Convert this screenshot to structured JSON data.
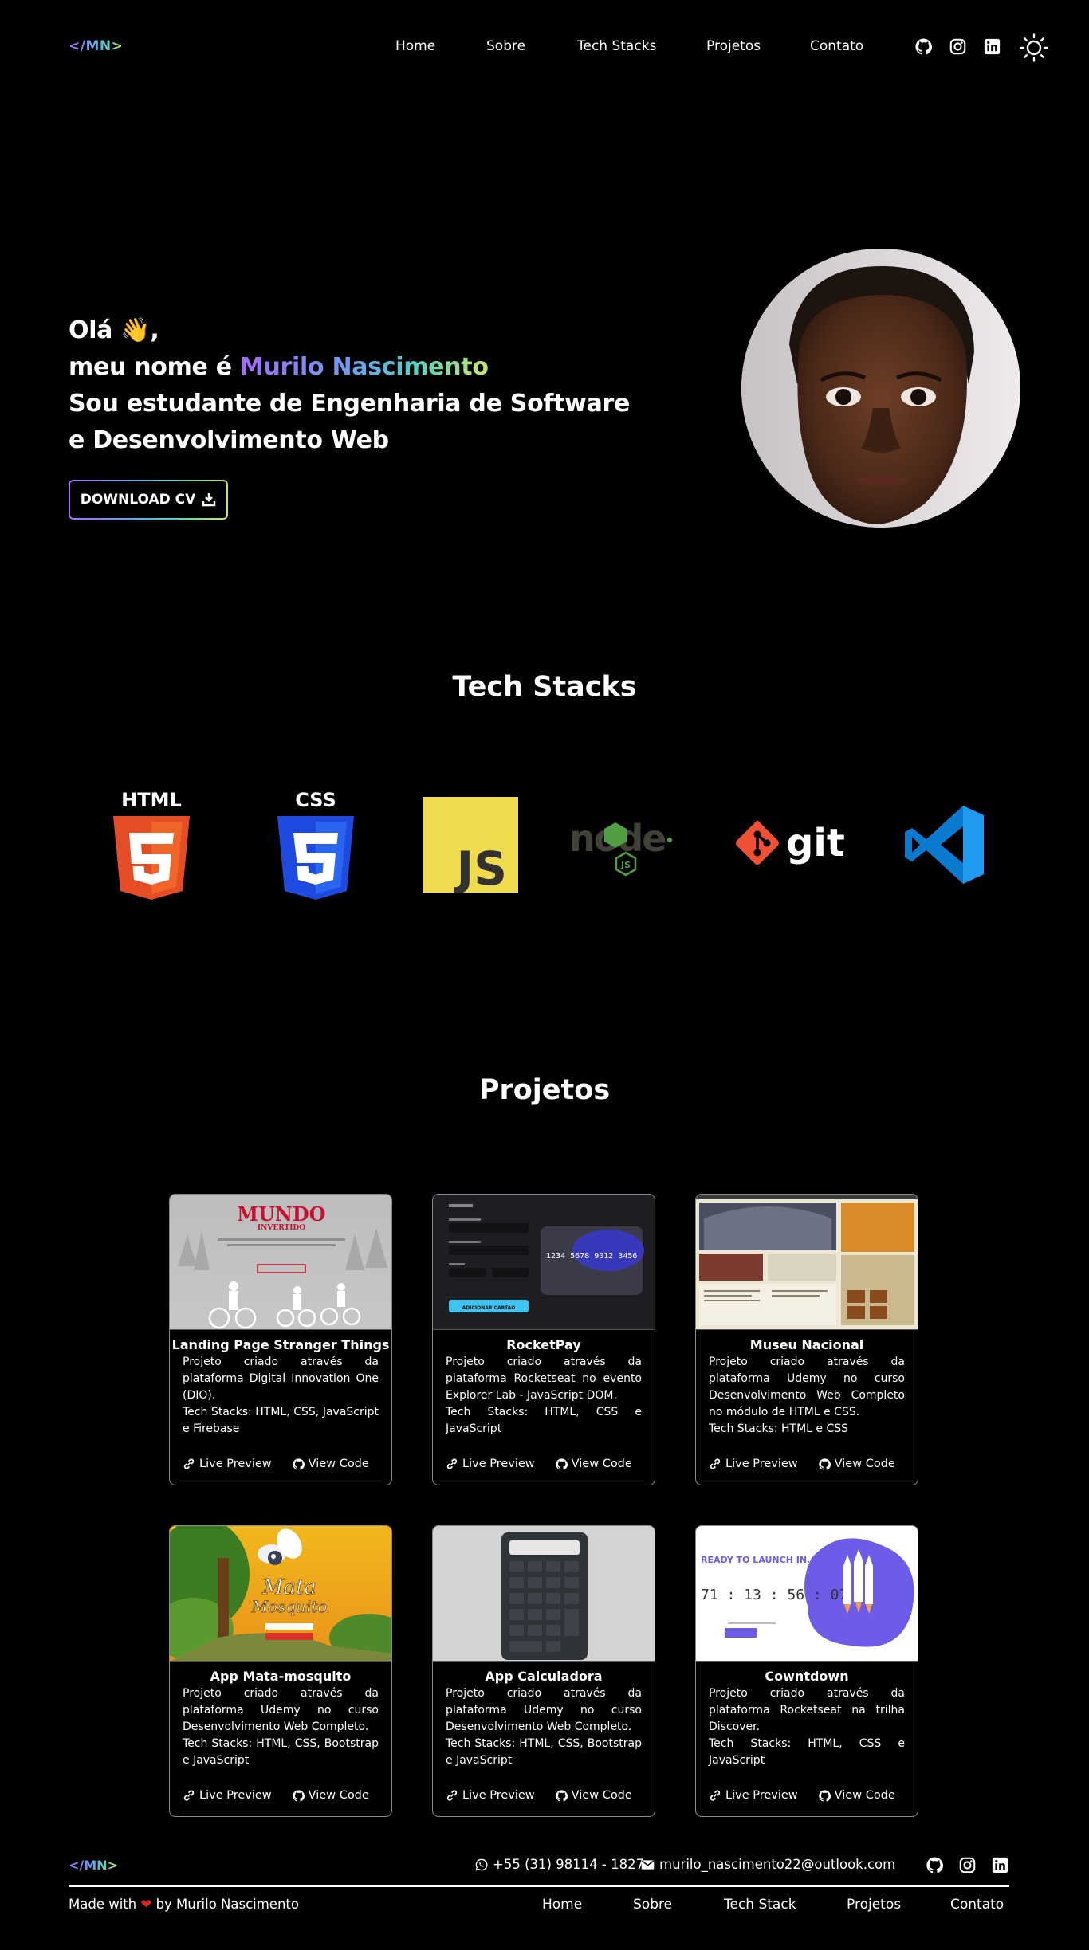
{
  "nav": {
    "logo": "</MN>",
    "links": [
      "Home",
      "Sobre",
      "Tech Stacks",
      "Projetos",
      "Contato"
    ],
    "icons": [
      "github-icon",
      "instagram-icon",
      "linkedin-icon"
    ],
    "theme_icon": "sun-icon"
  },
  "hero": {
    "greeting": "Olá 👋,",
    "name_prefix": "meu nome é ",
    "name": "Murilo Nascimento",
    "line3": "Sou estudante de Engenharia de Software",
    "line4": "e Desenvolvimento Web",
    "cv_button": "DOWNLOAD CV"
  },
  "tech_title": "Tech Stacks",
  "tech": {
    "html_label": "HTML",
    "css_label": "CSS",
    "js_label": "JS",
    "git_label": "git",
    "node_label": "node",
    "items": [
      "html5-logo",
      "css3-logo",
      "javascript-logo",
      "nodejs-logo",
      "git-logo",
      "vscode-logo"
    ]
  },
  "projects_title": "Projetos",
  "projects": [
    {
      "title": "Landing Page Stranger Things",
      "desc": "Projeto criado através da plataforma Digital Innovation One (DIO).",
      "stack": "Tech Stacks: HTML, CSS, JavaScript e Firebase",
      "thumb_text": "MUNDO",
      "thumb_sub": "INVERTIDO"
    },
    {
      "title": "RocketPay",
      "desc": "Projeto criado através da plataforma Rocketseat no evento Explorer Lab - JavaScript DOM.",
      "stack": "Tech Stacks: HTML, CSS e JavaScript",
      "thumb_text": "1234 5678 9012 3456",
      "thumb_sub": "ADICIONAR CARTÃO"
    },
    {
      "title": "Museu Nacional",
      "desc": "Projeto criado através da plataforma Udemy no curso Desenvolvimento Web Completo no módulo de HTML e CSS.",
      "stack": "Tech Stacks: HTML e CSS"
    },
    {
      "title": "App Mata-mosquito",
      "desc": "Projeto criado através da plataforma Udemy no curso Desenvolvimento Web Completo.",
      "stack": "Tech Stacks: HTML, CSS, Bootstrap e JavaScript",
      "thumb_text": "Mata",
      "thumb_sub": "Mosquito"
    },
    {
      "title": "App Calculadora",
      "desc": "Projeto criado através da plataforma Udemy no curso Desenvolvimento Web Completo.",
      "stack": "Tech Stacks: HTML, CSS, Bootstrap e JavaScript"
    },
    {
      "title": "Cowntdown",
      "desc": "Projeto criado através da plataforma Rocketseat na trilha Discover.",
      "stack": "Tech Stacks: HTML, CSS e JavaScript",
      "thumb_text": "READY TO LAUNCH IN...",
      "thumb_sub": "71 : 13 : 56 : 07"
    }
  ],
  "card_links": {
    "preview": "Live Preview",
    "code": "View Code"
  },
  "footer": {
    "logo": "</MN>",
    "phone": "+55 (31) 98114 - 1827",
    "email": "murilo_nascimento22@outlook.com",
    "made_prefix": "Made with",
    "made_suffix": "by Murilo Nascimento",
    "links": [
      "Home",
      "Sobre",
      "Tech Stack",
      "Projetos",
      "Contato"
    ]
  },
  "colors": {
    "background": "#000000",
    "accent_gradient": [
      "#a36bf4",
      "#6c9ff0",
      "#4fd1c5",
      "#c8e66a"
    ],
    "heart": "#e02424"
  }
}
